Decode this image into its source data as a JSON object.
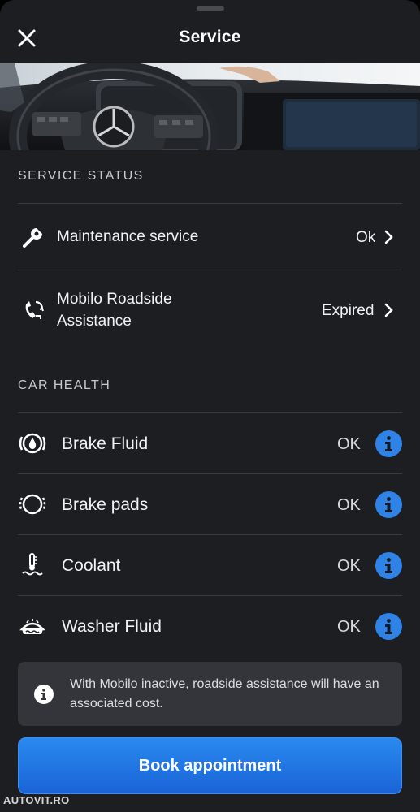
{
  "header": {
    "title": "Service",
    "close_icon": "close-icon"
  },
  "hero": {
    "description_icon": "car-interior-image"
  },
  "service_status": {
    "title": "SERVICE STATUS",
    "items": [
      {
        "icon": "wrench-icon",
        "label": "Maintenance service",
        "value": "Ok"
      },
      {
        "icon": "roadside-phone-icon",
        "label_line1": "Mobilo Roadside",
        "label_line2": "Assistance",
        "value": "Expired"
      }
    ]
  },
  "car_health": {
    "title": "CAR HEALTH",
    "items": [
      {
        "icon": "brake-fluid-icon",
        "label": "Brake Fluid",
        "value": "OK"
      },
      {
        "icon": "brake-pads-icon",
        "label": "Brake pads",
        "value": "OK"
      },
      {
        "icon": "coolant-icon",
        "label": "Coolant",
        "value": "OK"
      },
      {
        "icon": "washer-fluid-icon",
        "label": "Washer Fluid",
        "value": "OK"
      }
    ]
  },
  "notice": {
    "text": "With Mobilo inactive, roadside assistance will have an associated cost."
  },
  "cta": {
    "label": "Book appointment"
  },
  "watermark": "AUTOVIT.RO",
  "colors": {
    "background": "#1d1e22",
    "accent": "#2f83e6",
    "notice_bg": "#33353b"
  }
}
